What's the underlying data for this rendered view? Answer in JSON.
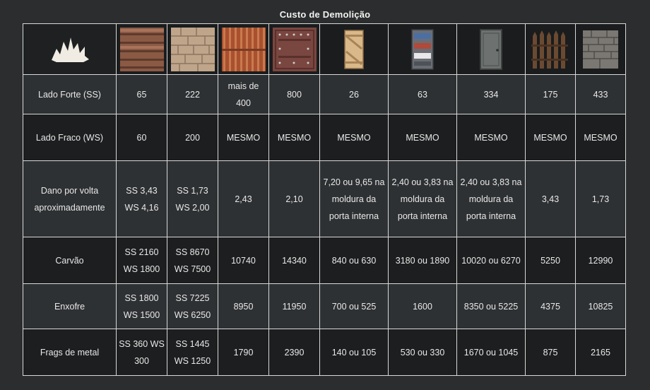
{
  "title": "Custo de Demolição",
  "icons": [
    "explosion-icon",
    "wood-wall-icon",
    "stone-wall-icon",
    "sheet-metal-wall-icon",
    "armored-wall-icon",
    "wood-door-icon",
    "sheet-metal-door-icon",
    "armored-door-icon",
    "wood-gate-icon",
    "stone-gate-icon"
  ],
  "rows": [
    {
      "label": "Lado Forte (SS)",
      "cells": [
        "65",
        "222",
        "mais de 400",
        "800",
        "26",
        "63",
        "334",
        "175",
        "433"
      ]
    },
    {
      "label": "Lado Fraco (WS)",
      "cells": [
        "60",
        "200",
        "MESMO",
        "MESMO",
        "MESMO",
        "MESMO",
        "MESMO",
        "MESMO",
        "MESMO"
      ]
    },
    {
      "label": "Dano por volta aproximadamente",
      "cells": [
        "SS 3,43 WS 4,16",
        "SS 1,73 WS 2,00",
        "2,43",
        "2,10",
        "7,20 ou 9,65 na moldura da porta interna",
        "2,40 ou 3,83 na moldura da porta interna",
        "2,40 ou 3,83 na moldura da porta interna",
        "3,43",
        "1,73"
      ]
    },
    {
      "label": "Carvão",
      "cells": [
        "SS 2160 WS 1800",
        "SS 8670 WS 7500",
        "10740",
        "14340",
        "840 ou 630",
        "3180 ou 1890",
        "10020 ou 6270",
        "5250",
        "12990"
      ]
    },
    {
      "label": "Enxofre",
      "cells": [
        "SS 1800 WS 1500",
        "SS 7225 WS 6250",
        "8950",
        "11950",
        "700 ou 525",
        "1600",
        "8350 ou 5225",
        "4375",
        "10825"
      ]
    },
    {
      "label": "Frags de metal",
      "cells": [
        "SS 360 WS 300",
        "SS 1445 WS 1250",
        "1790",
        "2390",
        "140 ou 105",
        "530 ou 330",
        "1670 ou 1045",
        "875",
        "2165"
      ]
    }
  ]
}
